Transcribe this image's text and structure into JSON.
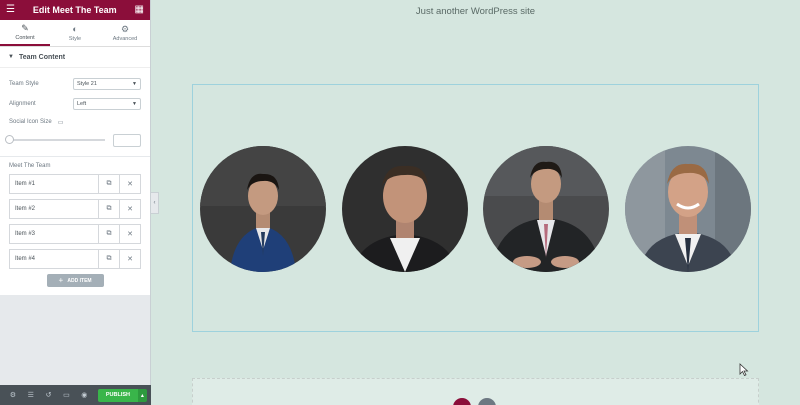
{
  "sidebar": {
    "title": "Edit Meet The Team",
    "tabs": [
      {
        "label": "Content",
        "icon": "pencil-icon"
      },
      {
        "label": "Style",
        "icon": "half-circle-icon"
      },
      {
        "label": "Advanced",
        "icon": "gear-icon"
      }
    ],
    "section_title": "Team Content",
    "team_style_label": "Team Style",
    "team_style_value": "Style 21",
    "alignment_label": "Alignment",
    "alignment_value": "Left",
    "social_icon_size_label": "Social Icon Size",
    "repeater_label": "Meet The Team",
    "items": [
      "Item #1",
      "Item #2",
      "Item #3",
      "Item #4"
    ],
    "add_item_label": "ADD ITEM",
    "publish_label": "PUBLISH"
  },
  "preview": {
    "tagline": "Just another WordPress site"
  },
  "colors": {
    "brand": "#8b0e3a",
    "publish": "#39b54a",
    "canvas": "#d5e6df"
  }
}
